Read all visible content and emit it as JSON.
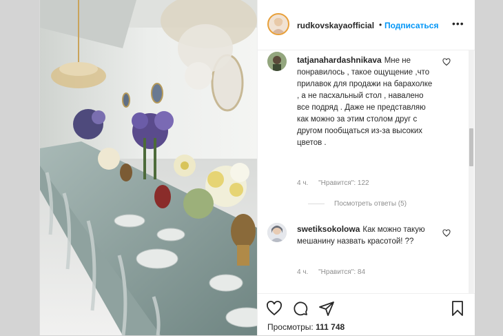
{
  "post": {
    "username": "rudkovskayaofficial",
    "dot": "•",
    "follow_label": "Подписаться",
    "more_label": "•••"
  },
  "comments": [
    {
      "username": "tatjanahardashnikava",
      "text": "Мне не понравилось , такое ощущение ,что прилавок для продажи на барахолке , а не пасхальный стол , навалено все подряд . Даже не представляю как можно за этим столом друг с другом пообщаться из-за высоких цветов .",
      "time": "4 ч.",
      "likes": "\"Нравится\": 122"
    },
    {
      "username": "swetiksokolowa",
      "text": "Как можно такую мешанину назвать красотой! ??",
      "time": "4 ч.",
      "likes": "\"Нравится\": 84"
    }
  ],
  "view_replies": "Посмотреть ответы (5)",
  "footer": {
    "views_label": "Просмотры:",
    "views_count": "111 748"
  },
  "icons": {
    "like": "heart-icon",
    "comment": "comment-icon",
    "share": "share-icon",
    "save": "bookmark-icon"
  }
}
